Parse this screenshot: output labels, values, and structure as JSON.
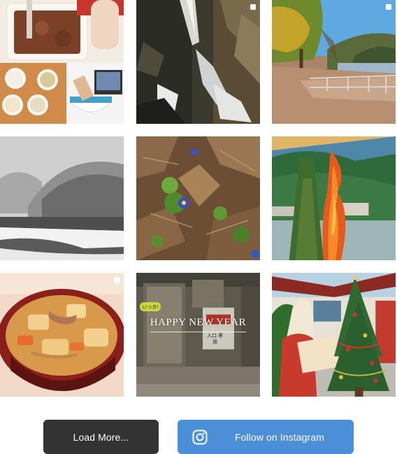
{
  "feed": {
    "tiles": [
      {
        "alt_subject": "baking"
      },
      {
        "alt_subject": "waterfall"
      },
      {
        "alt_subject": "riverside-autumn"
      },
      {
        "alt_subject": "snowy-valley"
      },
      {
        "alt_subject": "blue-flowers"
      },
      {
        "alt_subject": "bonfire"
      },
      {
        "alt_subject": "miso-soup"
      },
      {
        "alt_subject": "happy-new-year-shop",
        "overlay_badge": "いっき!",
        "overlay_text": "HAPPY NEW YEAR",
        "sign_text": "入口 専用"
      },
      {
        "alt_subject": "christmas-tree"
      }
    ]
  },
  "buttons": {
    "load_more": "Load More...",
    "follow": "Follow on Instagram"
  },
  "colors": {
    "load_more_bg": "#333333",
    "follow_bg": "#4a8fd8"
  }
}
